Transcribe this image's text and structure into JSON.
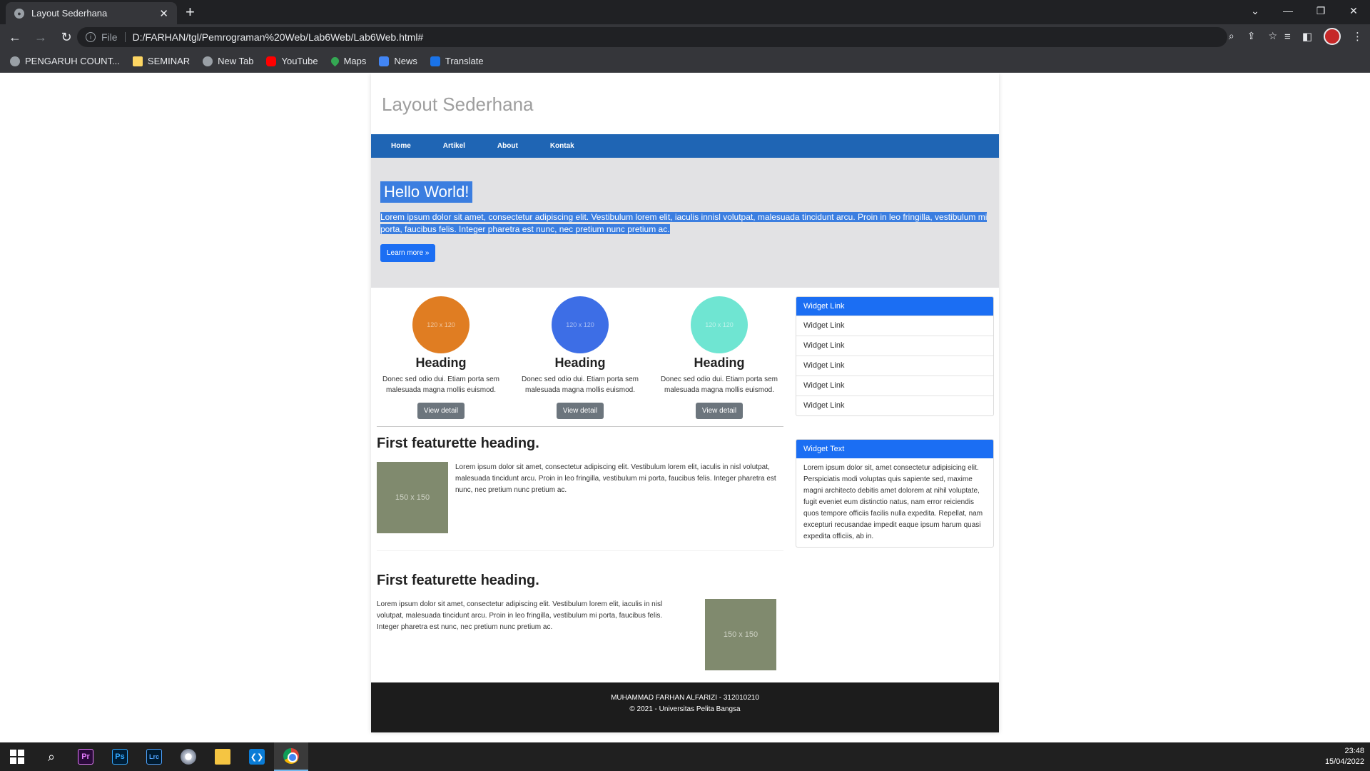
{
  "browser": {
    "tab_title": "Layout Sederhana",
    "url_scheme": "File",
    "url": "D:/FARHAN/tgl/Pemrograman%20Web/Lab6Web/Lab6Web.html#",
    "bookmarks": [
      {
        "label": "PENGARUH COUNT...",
        "icon": "globe-icon"
      },
      {
        "label": "SEMINAR",
        "icon": "folder-icon"
      },
      {
        "label": "New Tab",
        "icon": "globe-icon"
      },
      {
        "label": "YouTube",
        "icon": "youtube-icon"
      },
      {
        "label": "Maps",
        "icon": "maps-icon"
      },
      {
        "label": "News",
        "icon": "news-icon"
      },
      {
        "label": "Translate",
        "icon": "translate-icon"
      }
    ]
  },
  "site": {
    "title": "Layout Sederhana",
    "nav": [
      "Home",
      "Artikel",
      "About",
      "Kontak"
    ],
    "hero": {
      "title": "Hello World!",
      "text_line1": "Lorem ipsum dolor sit amet, consectetur adipiscing elit. Vestibulum lorem elit, iaculis innisl volutpat, malesuada tincidunt arcu. Proin in leo fringilla, vestibulum mi",
      "text_line2": "porta, faucibus felis. Integer pharetra est nunc, nec pretium nunc pretium ac.",
      "button": "Learn more »"
    },
    "cards": [
      {
        "placeholder": "120 x 120",
        "color": "#e07d22",
        "heading": "Heading",
        "text": "Donec sed odio dui. Etiam porta sem malesuada magna mollis euismod.",
        "button": "View detail"
      },
      {
        "placeholder": "120 x 120",
        "color": "#3d6ee6",
        "heading": "Heading",
        "text": "Donec sed odio dui. Etiam porta sem malesuada magna mollis euismod.",
        "button": "View detail"
      },
      {
        "placeholder": "120 x 120",
        "color": "#6fe5d2",
        "heading": "Heading",
        "text": "Donec sed odio dui. Etiam porta sem malesuada magna mollis euismod.",
        "button": "View detail"
      }
    ],
    "featurettes": [
      {
        "heading": "First featurette heading.",
        "image": "150 x 150",
        "text": "Lorem ipsum dolor sit amet, consectetur adipiscing elit. Vestibulum lorem elit, iaculis in nisl volutpat, malesuada tincidunt arcu. Proin in leo fringilla, vestibulum mi porta, faucibus felis. Integer pharetra est nunc, nec pretium nunc pretium ac."
      },
      {
        "heading": "First featurette heading.",
        "image": "150 x 150",
        "text": "Lorem ipsum dolor sit amet, consectetur adipiscing elit. Vestibulum lorem elit, iaculis in nisl volutpat, malesuada tincidunt arcu. Proin in leo fringilla, vestibulum mi porta, faucibus felis. Integer pharetra est nunc, nec pretium nunc pretium ac."
      }
    ],
    "sidebar": {
      "links_header": "Widget Link",
      "links": [
        "Widget Link",
        "Widget Link",
        "Widget Link",
        "Widget Link",
        "Widget Link"
      ],
      "text_header": "Widget Text",
      "text_body": "Lorem ipsum dolor sit, amet consectetur adipisicing elit. Perspiciatis modi voluptas quis sapiente sed, maxime magni architecto debitis amet dolorem at nihil voluptate, fugit eveniet eum distinctio natus, nam error reiciendis quos tempore officiis facilis nulla expedita. Repellat, nam excepturi recusandae impedit eaque ipsum harum quasi expedita officiis, ab in."
    },
    "footer": {
      "line1": "MUHAMMAD FARHAN ALFARIZI - 312010210",
      "line2": "© 2021 - Universitas Pelita Bangsa"
    }
  },
  "taskbar": {
    "apps": [
      "start-icon",
      "search-icon",
      "premiere-pro-icon",
      "photoshop-icon",
      "lightroom-classic-icon",
      "app-icon",
      "file-explorer-icon",
      "vscode-icon",
      "chrome-icon"
    ],
    "labels": {
      "pr": "Pr",
      "ps": "Ps",
      "lrc": "Lrc"
    },
    "time": "23:48",
    "date": "15/04/2022"
  }
}
